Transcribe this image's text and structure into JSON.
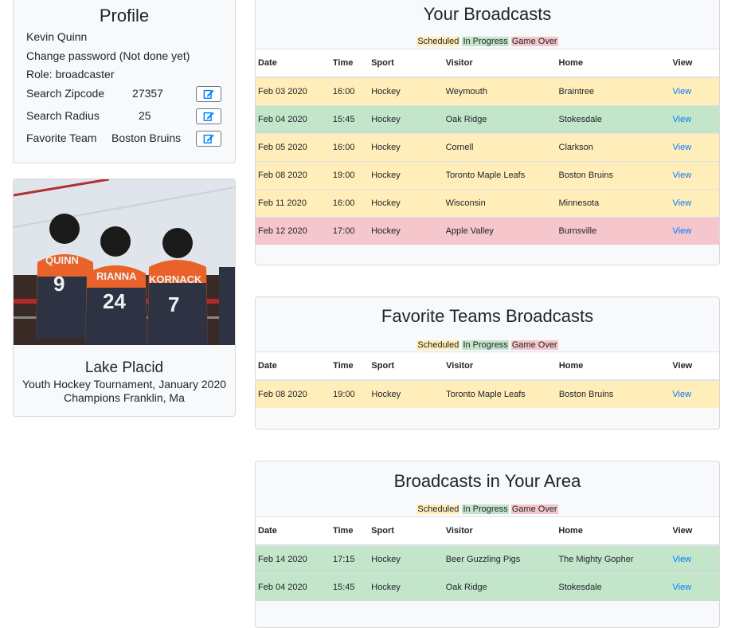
{
  "profile": {
    "title": "Profile",
    "name": "Kevin Quinn",
    "change_password": "Change password (Not done yet)",
    "role": "Role: broadcaster",
    "zipcode_label": "Search Zipcode",
    "zipcode_value": "27357",
    "radius_label": "Search Radius",
    "radius_value": "25",
    "team_label": "Favorite Team",
    "team_value": "Boston Bruins"
  },
  "photo_card": {
    "title": "Lake Placid",
    "line1": "Youth Hockey Tournament, January 2020",
    "line2": "Champions Franklin, Ma",
    "players": [
      "QUINN",
      "RIANNA",
      "KORNACK"
    ],
    "numbers": [
      "9",
      "24",
      "7"
    ]
  },
  "legend": {
    "scheduled": "Scheduled",
    "in_progress": "In Progress",
    "game_over": "Game Over"
  },
  "columns": {
    "date": "Date",
    "time": "Time",
    "sport": "Sport",
    "visitor": "Visitor",
    "home": "Home",
    "view": "View"
  },
  "colors": {
    "scheduled": "#ffeeba",
    "in_progress": "#c3e6cb",
    "game_over": "#f5c6cb",
    "link": "#007bff"
  },
  "sections": [
    {
      "title": "Your Broadcasts",
      "rows": [
        {
          "date": "Feb 03 2020",
          "time": "16:00",
          "sport": "Hockey",
          "visitor": "Weymouth",
          "home": "Braintree",
          "view": "View",
          "status": "sched"
        },
        {
          "date": "Feb 04 2020",
          "time": "15:45",
          "sport": "Hockey",
          "visitor": "Oak Ridge",
          "home": "Stokesdale",
          "view": "View",
          "status": "prog"
        },
        {
          "date": "Feb 05 2020",
          "time": "16:00",
          "sport": "Hockey",
          "visitor": "Cornell",
          "home": "Clarkson",
          "view": "View",
          "status": "sched"
        },
        {
          "date": "Feb 08 2020",
          "time": "19:00",
          "sport": "Hockey",
          "visitor": "Toronto Maple Leafs",
          "home": "Boston Bruins",
          "view": "View",
          "status": "sched"
        },
        {
          "date": "Feb 11 2020",
          "time": "16:00",
          "sport": "Hockey",
          "visitor": "Wisconsin",
          "home": "Minnesota",
          "view": "View",
          "status": "sched"
        },
        {
          "date": "Feb 12 2020",
          "time": "17:00",
          "sport": "Hockey",
          "visitor": "Apple Valley",
          "home": "Burnsville",
          "view": "View",
          "status": "over"
        }
      ]
    },
    {
      "title": "Favorite Teams Broadcasts",
      "rows": [
        {
          "date": "Feb 08 2020",
          "time": "19:00",
          "sport": "Hockey",
          "visitor": "Toronto Maple Leafs",
          "home": "Boston Bruins",
          "view": "View",
          "status": "sched"
        }
      ]
    },
    {
      "title": "Broadcasts in Your Area",
      "rows": [
        {
          "date": "Feb 14 2020",
          "time": "17:15",
          "sport": "Hockey",
          "visitor": "Beer Guzzling Pigs",
          "home": "The Mighty Gopher",
          "view": "View",
          "status": "prog"
        },
        {
          "date": "Feb 04 2020",
          "time": "15:45",
          "sport": "Hockey",
          "visitor": "Oak Ridge",
          "home": "Stokesdale",
          "view": "View",
          "status": "prog"
        }
      ]
    }
  ]
}
